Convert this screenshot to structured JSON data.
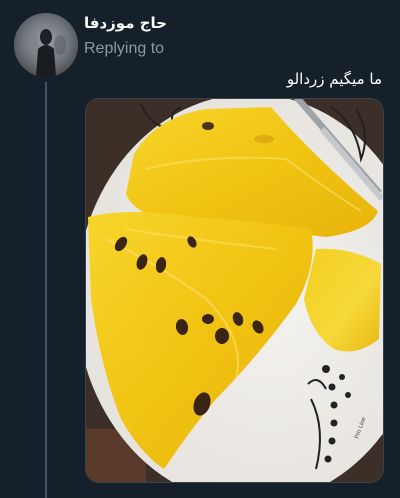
{
  "tweet": {
    "author_display_name": "حاج موزدفا",
    "replying_to_label": "Replying to",
    "replying_to_handle": "",
    "text": "ما میگیم زردالو"
  },
  "media": {
    "icon": "photo",
    "plate_label": "Pro Line"
  },
  "colors": {
    "background": "#15202b",
    "secondary_text": "#8b98a5",
    "thread_line": "#3d5466",
    "media_border": "#38444d",
    "watermelon_flesh": "#f5c817",
    "seed": "#3a2414"
  }
}
